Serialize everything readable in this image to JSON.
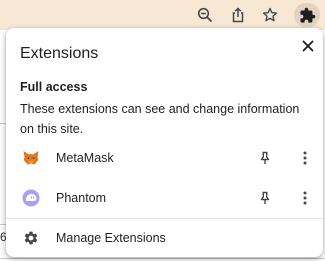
{
  "toolbar": {
    "icons": [
      "zoom-out-icon",
      "share-icon",
      "bookmark-star-icon",
      "extensions-puzzle-icon"
    ],
    "colors": {
      "background": "#f7e8d6",
      "active": "#e3d2bf"
    }
  },
  "background_page": {
    "left_glyph": "6"
  },
  "panel": {
    "title": "Extensions",
    "close_icon": "close-icon",
    "section": {
      "title": "Full access",
      "description": "These extensions can see and change information on this site."
    },
    "extensions": [
      {
        "name": "MetaMask",
        "icon": "metamask-fox-icon"
      },
      {
        "name": "Phantom",
        "icon": "phantom-ghost-icon"
      }
    ],
    "manage_label": "Manage Extensions",
    "manage_icon": "gear-icon",
    "colors": {
      "metamask": "#e2761b",
      "phantom": "#ab9ff2",
      "text": "#1f1f1f",
      "icon": "#474747"
    }
  }
}
